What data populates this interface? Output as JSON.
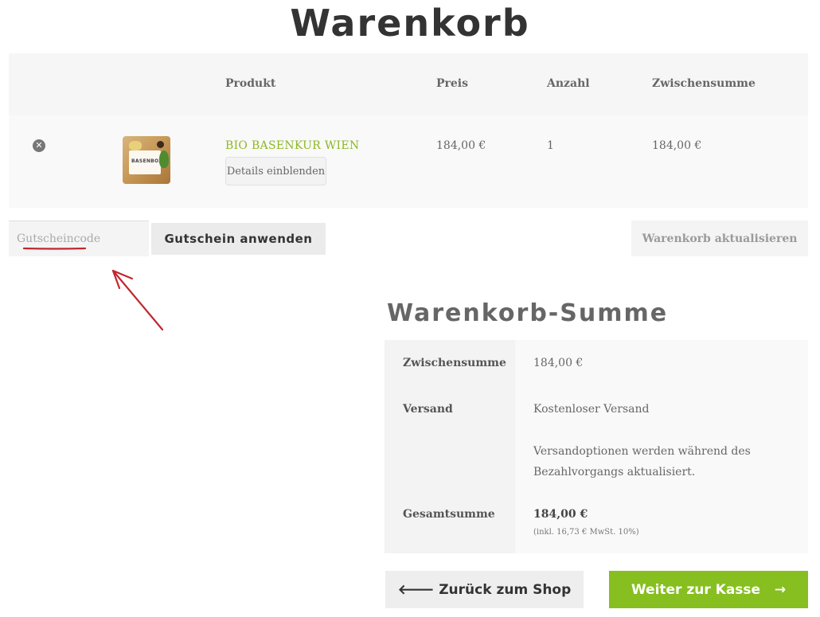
{
  "page": {
    "title": "Warenkorb"
  },
  "cart": {
    "columns": {
      "product": "Produkt",
      "price": "Preis",
      "quantity": "Anzahl",
      "subtotal": "Zwischensumme"
    },
    "items": [
      {
        "thumb_label": "BASENBOX",
        "name": "BIO BASENKUR WIEN",
        "details_label": "Details einblenden",
        "price": "184,00 €",
        "quantity": "1",
        "subtotal": "184,00 €"
      }
    ],
    "coupon": {
      "placeholder": "Gutscheincode",
      "apply_label": "Gutschein anwenden"
    },
    "update_label": "Warenkorb aktualisieren"
  },
  "totals": {
    "title": "Warenkorb-Summe",
    "subtotal_label": "Zwischensumme",
    "subtotal_value": "184,00 €",
    "shipping_label": "Versand",
    "shipping_value": "Kostenloser Versand",
    "shipping_note": "Versandoptionen werden während des Bezahlvorgangs aktualisiert.",
    "total_label": "Gesamtsumme",
    "total_value": "184,00 €",
    "tax_note": "(inkl. 16,73 € MwSt. 10%)"
  },
  "actions": {
    "back_label": "Zurück zum Shop",
    "checkout_label": "Weiter zur Kasse"
  },
  "colors": {
    "accent": "#86bf1f",
    "link": "#8db822",
    "annotation": "#c0272d"
  }
}
